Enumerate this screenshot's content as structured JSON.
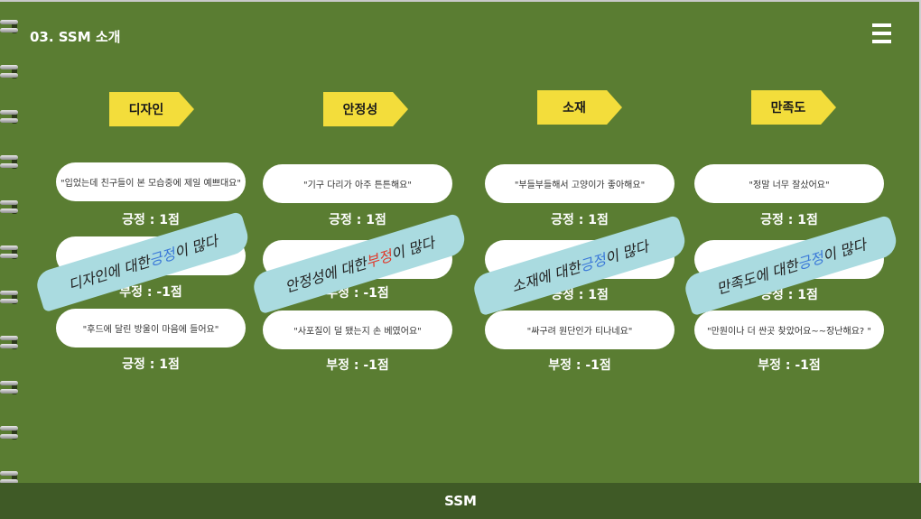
{
  "header": {
    "title": "03. SSM 소개",
    "menu_icon": "hamburger-menu-icon"
  },
  "columns": [
    {
      "tag": "디자인",
      "reviews": [
        {
          "quote": "\"입었는데 친구들이 본 모습중에 제일 예쁘대요\"",
          "score": "긍정 : 1점"
        },
        {
          "quote": "",
          "score": "부정 : -1점"
        },
        {
          "quote": "\"후드에 달린 방울이 마음에 들어요\"",
          "score": "긍정 : 1점"
        }
      ],
      "stroke": {
        "before": "디자인에 대한 ",
        "keyword": "긍정",
        "after": "이 많다"
      }
    },
    {
      "tag": "안정성",
      "reviews": [
        {
          "quote": "\"기구 다리가 아주 튼튼해요\"",
          "score": "긍정 : 1점"
        },
        {
          "quote": "",
          "score": "부정 : -1점"
        },
        {
          "quote": "\"사포질이 덜 됐는지 손 베였어요\"",
          "score": "부정 : -1점"
        }
      ],
      "stroke": {
        "before": "안정성에 대한 ",
        "keyword": "부정",
        "after": "이 많다"
      }
    },
    {
      "tag": "소재",
      "reviews": [
        {
          "quote": "\"부들부들해서 고양이가 좋아해요\"",
          "score": "긍정 : 1점"
        },
        {
          "quote": "",
          "score": "긍정 : 1점"
        },
        {
          "quote": "\"싸구려 원단인가 티나네요\"",
          "score": "부정 : -1점"
        }
      ],
      "stroke": {
        "before": "소재에 대한 ",
        "keyword": "긍정",
        "after": "이 많다"
      }
    },
    {
      "tag": "만족도",
      "reviews": [
        {
          "quote": "\"정말 너무 잘샀어요\"",
          "score": "긍정 : 1점"
        },
        {
          "quote": "",
          "score": "긍정 : 1점"
        },
        {
          "quote": "\"만원이나 더 싼곳 찾았어요~~장난해요? \"",
          "score": "부정 : -1점"
        }
      ],
      "stroke": {
        "before": "만족도에 대한 ",
        "keyword": "긍정",
        "after": "이 많다"
      }
    }
  ],
  "footer": {
    "label": "SSM"
  },
  "colors": {
    "background": "#5a7d32",
    "tag": "#f3dd3b",
    "stroke": "#aadbe0",
    "positive_keyword": "#3a78d8",
    "negative_keyword": "#e0392b",
    "footer": "#3f5a26"
  }
}
